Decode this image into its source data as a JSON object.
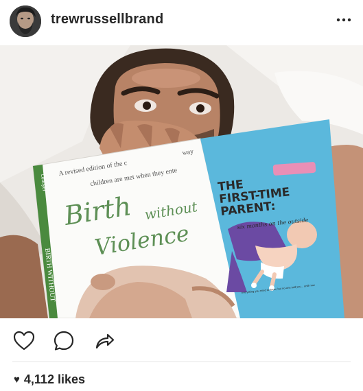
{
  "post": {
    "username": "trewrussellbrand",
    "likes_label": "4,112 likes"
  },
  "book1": {
    "tagline_1": "A revised edition of the c",
    "tagline_1_end": "way",
    "tagline_2": "children are met when they ente",
    "title_birth": "Birth",
    "title_without": "without",
    "title_violence": "Violence",
    "spine": "BIRTH WITHOUT",
    "spine_author": "Leboyer"
  },
  "book2": {
    "title_line1": "THE",
    "title_line2": "FIRST-TIME",
    "title_line3": "PARENT:",
    "subtitle": "six months on the outside",
    "footer": "everything you need to know, but no-one told you... until now"
  },
  "icons": {
    "more": "more-horizontal-icon",
    "like": "heart-outline-icon",
    "comment": "comment-bubble-icon",
    "share": "share-arrow-icon",
    "likes": "heart-filled-icon"
  },
  "colors": {
    "text": "#262626",
    "book2_cover": "#5bb8dc",
    "book1_green": "#4a8a3e"
  }
}
